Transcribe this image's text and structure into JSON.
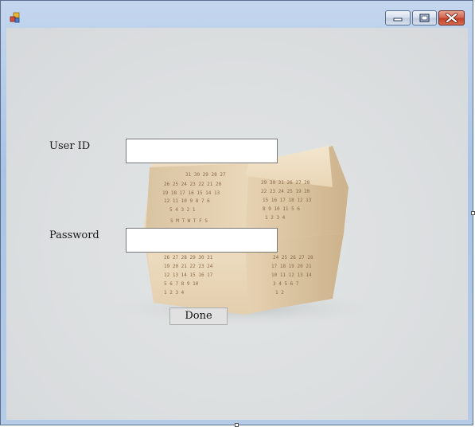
{
  "window": {
    "title": ""
  },
  "titlebar": {
    "icons": [
      "app-icon",
      "minimize-icon",
      "maximize-icon",
      "close-icon"
    ]
  },
  "form": {
    "user_id_label": "User ID",
    "user_id_value": "",
    "password_label": "Password",
    "password_value": "",
    "done_label": "Done"
  },
  "background_image": {
    "subject": "wooden dodecahedron calendar"
  }
}
